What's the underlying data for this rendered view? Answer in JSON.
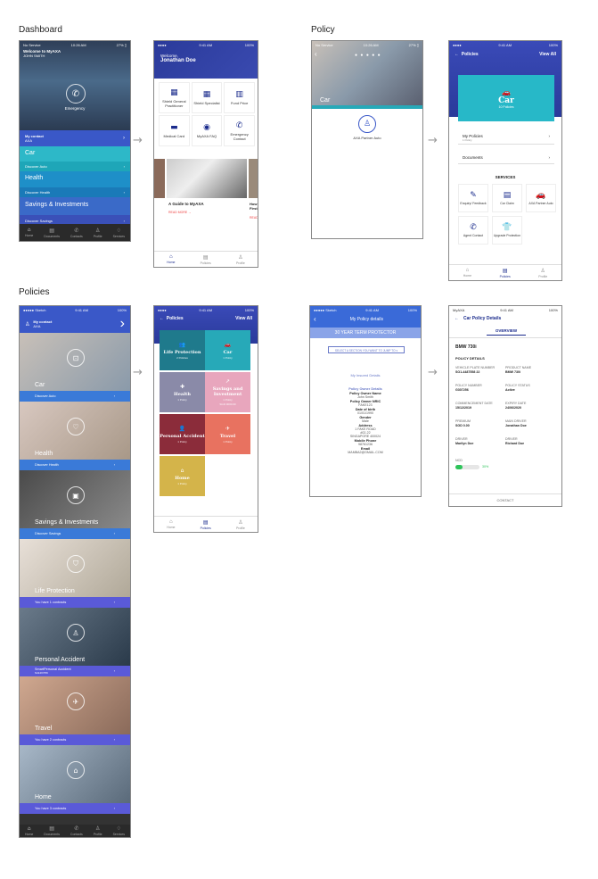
{
  "sections": {
    "dashboard": "Dashboard",
    "policy": "Policy",
    "policies": "Policies"
  },
  "arrow_glyph": "→",
  "dash1": {
    "status_left": "No Service",
    "status_time": "10:26 AM",
    "status_right": "27% ▯",
    "welcome": "Welcome to MyAXA",
    "user": "JOHN SMITH",
    "emergency": "Emergency",
    "contact_label": "My contact",
    "contact_value": "AXA",
    "bands": [
      {
        "title": "Car",
        "sub": "Discover Auto"
      },
      {
        "title": "Health",
        "sub": "Discover Health"
      },
      {
        "title": "Savings & Investments",
        "sub": "Discover Savings"
      }
    ],
    "tabs": [
      "Home",
      "Documents",
      "Contacts",
      "Profile",
      "Services"
    ]
  },
  "dash2": {
    "status_time": "9:41 AM",
    "status_right": "100%",
    "welcome": "Welcome,",
    "name": "Jonathan Doe",
    "grid": [
      {
        "icon": "clinic-icon",
        "glyph": "▦",
        "label": "Shield General Practitioner"
      },
      {
        "icon": "specialist-icon",
        "glyph": "▦",
        "label": "Shield Specialist"
      },
      {
        "icon": "fund-price-icon",
        "glyph": "▥",
        "label": "Fund Price"
      },
      {
        "icon": "medical-card-icon",
        "glyph": "▬",
        "label": "Medical Card"
      },
      {
        "icon": "faq-icon",
        "glyph": "◉",
        "label": "MyAXA FAQ"
      },
      {
        "icon": "phone-icon",
        "glyph": "✆",
        "label": "Emergency Contact"
      }
    ],
    "article_title": "A Guide to MyAXA",
    "article_more": "READ MORE →",
    "side_title": "How First",
    "side_more": "READ",
    "tabs": [
      "Home",
      "Policies",
      "Profile"
    ]
  },
  "pol1": {
    "status_left": "No Service",
    "status_time": "10:26 AM",
    "status_right": "27% ▯",
    "title": "Car",
    "partner": "AXA Partner Auto"
  },
  "pol2": {
    "status_time": "9:41 AM",
    "status_right": "100%",
    "header": "Policies",
    "view_all": "View All",
    "car_title": "Car",
    "car_sub": "10 Policies",
    "list": [
      "My Policies",
      "Documents"
    ],
    "list_sub": "1 Policy",
    "services_title": "SERVICES",
    "services": [
      {
        "icon": "pen-icon",
        "glyph": "✎",
        "label": "Enquiry/ Feedback"
      },
      {
        "icon": "claim-icon",
        "glyph": "▤",
        "label": "Car Claim"
      },
      {
        "icon": "car-icon",
        "glyph": "🚗",
        "label": "AXA Partner Auto"
      },
      {
        "icon": "agent-icon",
        "glyph": "✆",
        "label": "Agent Contact"
      },
      {
        "icon": "shirt-icon",
        "glyph": "👕",
        "label": "Upgrade Protection"
      }
    ],
    "tabs": [
      "Home",
      "Policies",
      "Profile"
    ]
  },
  "list1": {
    "status_left": "●●●●● Sketch",
    "status_time": "9:41 AM",
    "status_right": "100%",
    "contact_label": "My contact",
    "contact_value": "AXA",
    "items": [
      {
        "title": "Car",
        "sub": "Discover Auto"
      },
      {
        "title": "Health",
        "sub": "Discover Health"
      },
      {
        "title": "Savings & Investments",
        "sub": "Discover Savings"
      },
      {
        "title": "Life Protection",
        "sub": "You have 1 contracts"
      },
      {
        "title": "Personal Accident",
        "sub": "SmartPersonal Accident",
        "sub2": "S414X7PD"
      },
      {
        "title": "Travel",
        "sub": "You have 2 contracts"
      },
      {
        "title": "Home",
        "sub": "You have 3 contracts"
      }
    ],
    "tabs": [
      "Home",
      "Documents",
      "Contacts",
      "Profile",
      "Services"
    ]
  },
  "list2": {
    "status_time": "9:41 AM",
    "status_right": "100%",
    "header": "Policies",
    "view_all": "View All",
    "tiles": [
      {
        "icon": "user-icon",
        "glyph": "👥",
        "name": "Life Protection",
        "sub": "2 Policies",
        "color": "#1f7a8c"
      },
      {
        "icon": "car-icon",
        "glyph": "🚗",
        "name": "Car",
        "sub": "1 Policy",
        "color": "#27a9b8"
      },
      {
        "icon": "health-icon",
        "glyph": "✚",
        "name": "Health",
        "sub": "1 Policy",
        "color": "#8a8aa8"
      },
      {
        "icon": "savings-icon",
        "glyph": "↗",
        "name": "Savings and Investment",
        "sub": "1 Policy",
        "extra": "SGD 0000.00",
        "color": "#e8a6bd"
      },
      {
        "icon": "person-icon",
        "glyph": "👤",
        "name": "Personal Accident",
        "sub": "1 Policy",
        "color": "#8b2c3a"
      },
      {
        "icon": "plane-icon",
        "glyph": "✈",
        "name": "Travel",
        "sub": "1 Policy",
        "color": "#e87260"
      },
      {
        "icon": "home-icon",
        "glyph": "⌂",
        "name": "Home",
        "sub": "1 Policy",
        "color": "#d4b44a"
      }
    ],
    "tabs": [
      "Home",
      "Policies",
      "Profile"
    ]
  },
  "detail1": {
    "status_left": "●●●●● Sketch",
    "status_time": "9:41 AM",
    "status_right": "100%",
    "header": "My Policy details",
    "banner": "30 YEAR TERM PROTECTOR",
    "select": "SELECT A SECTION YOU WANT TO JUMP TO ▾",
    "insured": "My Insured Details",
    "fields": [
      {
        "k": "Policy Owner Details",
        "v": ""
      },
      {
        "k": "Policy Owner Name",
        "v": "John Smith"
      },
      {
        "k": "Policy Owner NRIC",
        "v": "FAKE123"
      },
      {
        "k": "Date of birth",
        "v": "01/01/1990"
      },
      {
        "k": "Gender",
        "v": "Male"
      },
      {
        "k": "Address",
        "v": "1 FAKE ROAD"
      },
      {
        "k": "",
        "v": "#02-22"
      },
      {
        "k": "",
        "v": "SINGAPORE 400024"
      },
      {
        "k": "Mobile Phone",
        "v": "98761236"
      },
      {
        "k": "Email",
        "v": "MAMBA2@GMAIL.COM"
      }
    ]
  },
  "detail2": {
    "status_left": "MyAXA",
    "status_time": "9:41 AM",
    "status_right": "100%",
    "header": "Car Policy Details",
    "tab": "OVERVIEW",
    "car": "BMW 730i",
    "section": "POLICY DETAILS",
    "rows": [
      [
        {
          "k": "VEHICLE PLATE NUMBER",
          "v": "SO1-4487558 22"
        },
        {
          "k": "PRODUCT NAME",
          "v": "BMW 730i"
        }
      ],
      [
        {
          "k": "POLICY NUMBER",
          "v": "G307256"
        },
        {
          "k": "POLICY STATUS",
          "v": "Active"
        }
      ],
      [
        {
          "k": "COMMENCEMENT DATE",
          "v": "15/12/2019"
        },
        {
          "k": "EXPIRY DATE",
          "v": "24/06/2020"
        }
      ],
      [
        {
          "k": "PREMIUM",
          "v": "SGD 0.00"
        },
        {
          "k": "MAIN DRIVER",
          "v": "Jonathan Doe"
        }
      ],
      [
        {
          "k": "DRIVER",
          "v": "Marilyn Doe"
        },
        {
          "k": "DRIVER",
          "v": "Richard Doe"
        }
      ]
    ],
    "ncd_label": "NCD",
    "ncd_value": 0.3,
    "ncd_text": "30%",
    "footer": "CONTACT"
  }
}
